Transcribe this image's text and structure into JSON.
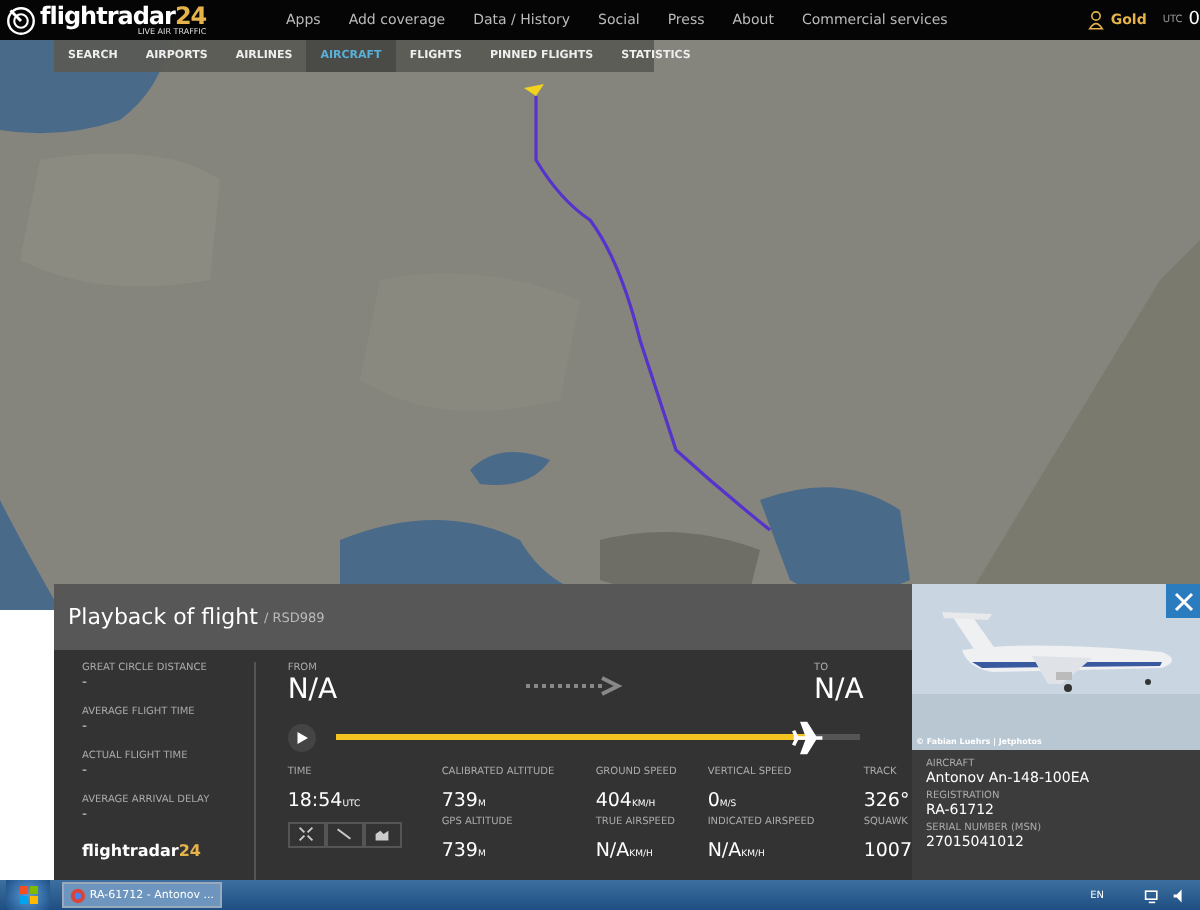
{
  "header": {
    "logo_name": "flightradar",
    "logo_number": "24",
    "tagline": "LIVE AIR TRAFFIC",
    "nav": [
      "Apps",
      "Add coverage",
      "Data / History",
      "Social",
      "Press",
      "About",
      "Commercial services"
    ],
    "user": "Gold",
    "utc_label": "UTC",
    "utc_value": "0"
  },
  "subnav": [
    {
      "label": "SEARCH",
      "selected": false
    },
    {
      "label": "AIRPORTS",
      "selected": false
    },
    {
      "label": "AIRLINES",
      "selected": false
    },
    {
      "label": "AIRCRAFT",
      "selected": true
    },
    {
      "label": "FLIGHTS",
      "selected": false
    },
    {
      "label": "PINNED FLIGHTS",
      "selected": false
    },
    {
      "label": "STATISTICS",
      "selected": false
    }
  ],
  "playback": {
    "title": "Playback of flight",
    "flight": "/ RSD989",
    "stats": [
      {
        "label": "GREAT CIRCLE DISTANCE",
        "value": "-"
      },
      {
        "label": "AVERAGE FLIGHT TIME",
        "value": "-"
      },
      {
        "label": "ACTUAL FLIGHT TIME",
        "value": "-"
      },
      {
        "label": "AVERAGE ARRIVAL DELAY",
        "value": "-"
      }
    ],
    "logo_name": "flightradar",
    "logo_number": "24",
    "from_label": "FROM",
    "from": "N/A",
    "to_label": "TO",
    "to": "N/A",
    "progress": {
      "level": 0.9
    },
    "readings": [
      [
        {
          "label": "TIME",
          "value": "18:54",
          "unit": "UTC"
        }
      ],
      [
        {
          "label": "CALIBRATED ALTITUDE",
          "value": "739",
          "unit": "M"
        },
        {
          "label": "GPS ALTITUDE",
          "value": "739",
          "unit": "M"
        }
      ],
      [
        {
          "label": "GROUND SPEED",
          "value": "404",
          "unit": "KM/H"
        },
        {
          "label": "TRUE AIRSPEED",
          "value": "N/A",
          "unit": "KM/H"
        }
      ],
      [
        {
          "label": "VERTICAL SPEED",
          "value": "0",
          "unit": "M/S"
        },
        {
          "label": "INDICATED AIRSPEED",
          "value": "N/A",
          "unit": "KM/H"
        }
      ],
      [
        {
          "label": "TRACK",
          "value": "326°"
        },
        {
          "label": "SQUAWK",
          "value": "1007"
        }
      ]
    ]
  },
  "aircraft": {
    "photo_credit": "© Fabian Luehrs | Jetphotos",
    "fields": [
      {
        "label": "AIRCRAFT",
        "value": "Antonov An-148-100EA"
      },
      {
        "label": "REGISTRATION",
        "value": "RA-61712"
      },
      {
        "label": "SERIAL NUMBER (MSN)",
        "value": "27015041012"
      }
    ]
  },
  "taskbar": {
    "task": "RA-61712 - Antonov ...",
    "language": "EN"
  }
}
